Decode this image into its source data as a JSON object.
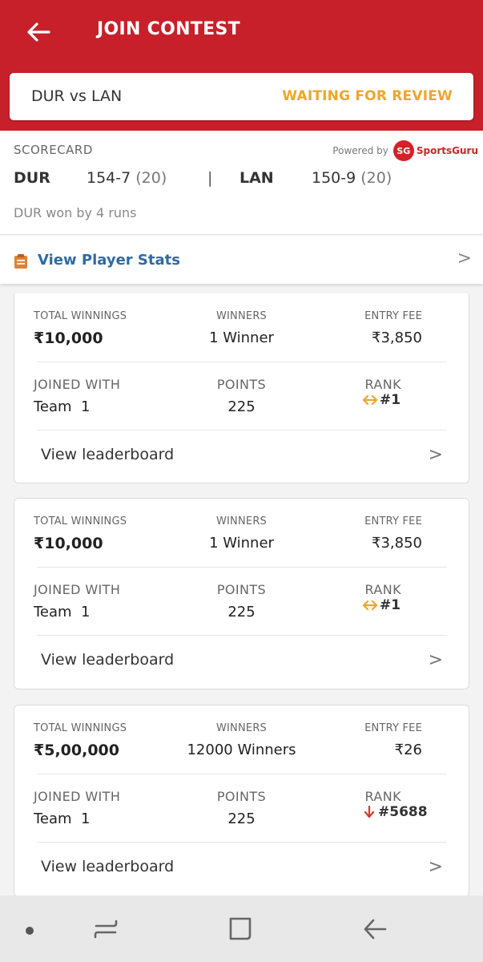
{
  "header": {
    "title": "JOIN CONTEST",
    "back_icon": "arrow-left-icon",
    "color": "#c8202a"
  },
  "match": {
    "title": "DUR vs LAN",
    "status": "WAITING FOR REVIEW",
    "status_color": "#f0a52a"
  },
  "scorecard": {
    "label": "SCORECARD",
    "powered_by": "Powered by",
    "provider_logo": "SG",
    "provider_name": "SportsGuru",
    "team1": {
      "name": "DUR",
      "score": "154-7",
      "overs": "(20)"
    },
    "separator": "|",
    "team2": {
      "name": "LAN",
      "score": "150-9",
      "overs": "(20)"
    },
    "result": "DUR won by 4 runs"
  },
  "player_stats": {
    "label": "View Player Stats",
    "chevron": ">"
  },
  "labels": {
    "total_winnings": "TOTAL WINNINGS",
    "winners": "WINNERS",
    "entry_fee": "ENTRY FEE",
    "joined_with": "JOINED WITH",
    "points": "POINTS",
    "rank": "RANK",
    "view_leaderboard": "View leaderboard",
    "chevron": ">"
  },
  "contests": [
    {
      "total_winnings": "₹10,000",
      "winners": "1 Winner",
      "entry_fee": "₹3,850",
      "joined_with": "Team  1",
      "points": "225",
      "rank": "#1",
      "rank_trend": "neutral"
    },
    {
      "total_winnings": "₹10,000",
      "winners": "1 Winner",
      "entry_fee": "₹3,850",
      "joined_with": "Team  1",
      "points": "225",
      "rank": "#1",
      "rank_trend": "neutral"
    },
    {
      "total_winnings": "₹5,00,000",
      "winners": "12000 Winners",
      "entry_fee": "₹26",
      "joined_with": "Team  1",
      "points": "225",
      "rank": "#5688",
      "rank_trend": "down"
    }
  ],
  "navbar": {
    "items": [
      "home-dot-icon",
      "recent-apps-icon",
      "home-square-icon",
      "back-arrow-icon"
    ]
  }
}
